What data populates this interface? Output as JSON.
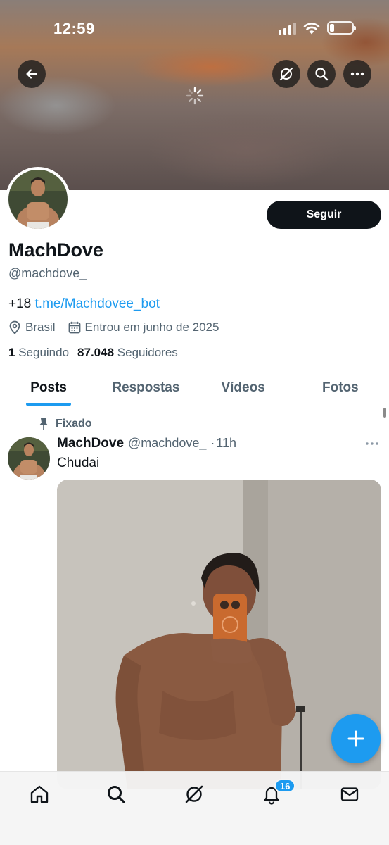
{
  "status_bar": {
    "time": "12:59",
    "battery_level": 0.2
  },
  "header": {
    "back_icon": "arrow-left-icon",
    "grok_icon": "grok-icon",
    "search_icon": "search-icon",
    "more_icon": "more-horizontal-icon",
    "loading_icon": "spinner-icon"
  },
  "profile": {
    "display_name": "MachDove",
    "handle": "@machdove_",
    "follow_label": "Seguir",
    "bio_prefix": "+18",
    "bio_link": "t.me/Machdovee_bot",
    "location": "Brasil",
    "joined": "Entrou em junho de 2025",
    "following_count": "1",
    "following_label": "Seguindo",
    "followers_count": "87.048",
    "followers_label": "Seguidores"
  },
  "tabs": [
    {
      "label": "Posts",
      "active": true
    },
    {
      "label": "Respostas",
      "active": false
    },
    {
      "label": "Vídeos",
      "active": false
    },
    {
      "label": "Fotos",
      "active": false
    }
  ],
  "post": {
    "pinned_label": "Fixado",
    "author_name": "MachDove",
    "author_handle": "@machdove_",
    "separator": "·",
    "time": "11h",
    "text": "Chudai"
  },
  "fab_icon": "plus-icon",
  "bottom_nav": {
    "items": [
      "home-icon",
      "search-icon",
      "grok-icon",
      "bell-icon",
      "mail-icon"
    ],
    "notifications_badge": "16"
  },
  "colors": {
    "accent": "#1d9bf0",
    "text": "#0f1419",
    "secondary": "#536471"
  }
}
